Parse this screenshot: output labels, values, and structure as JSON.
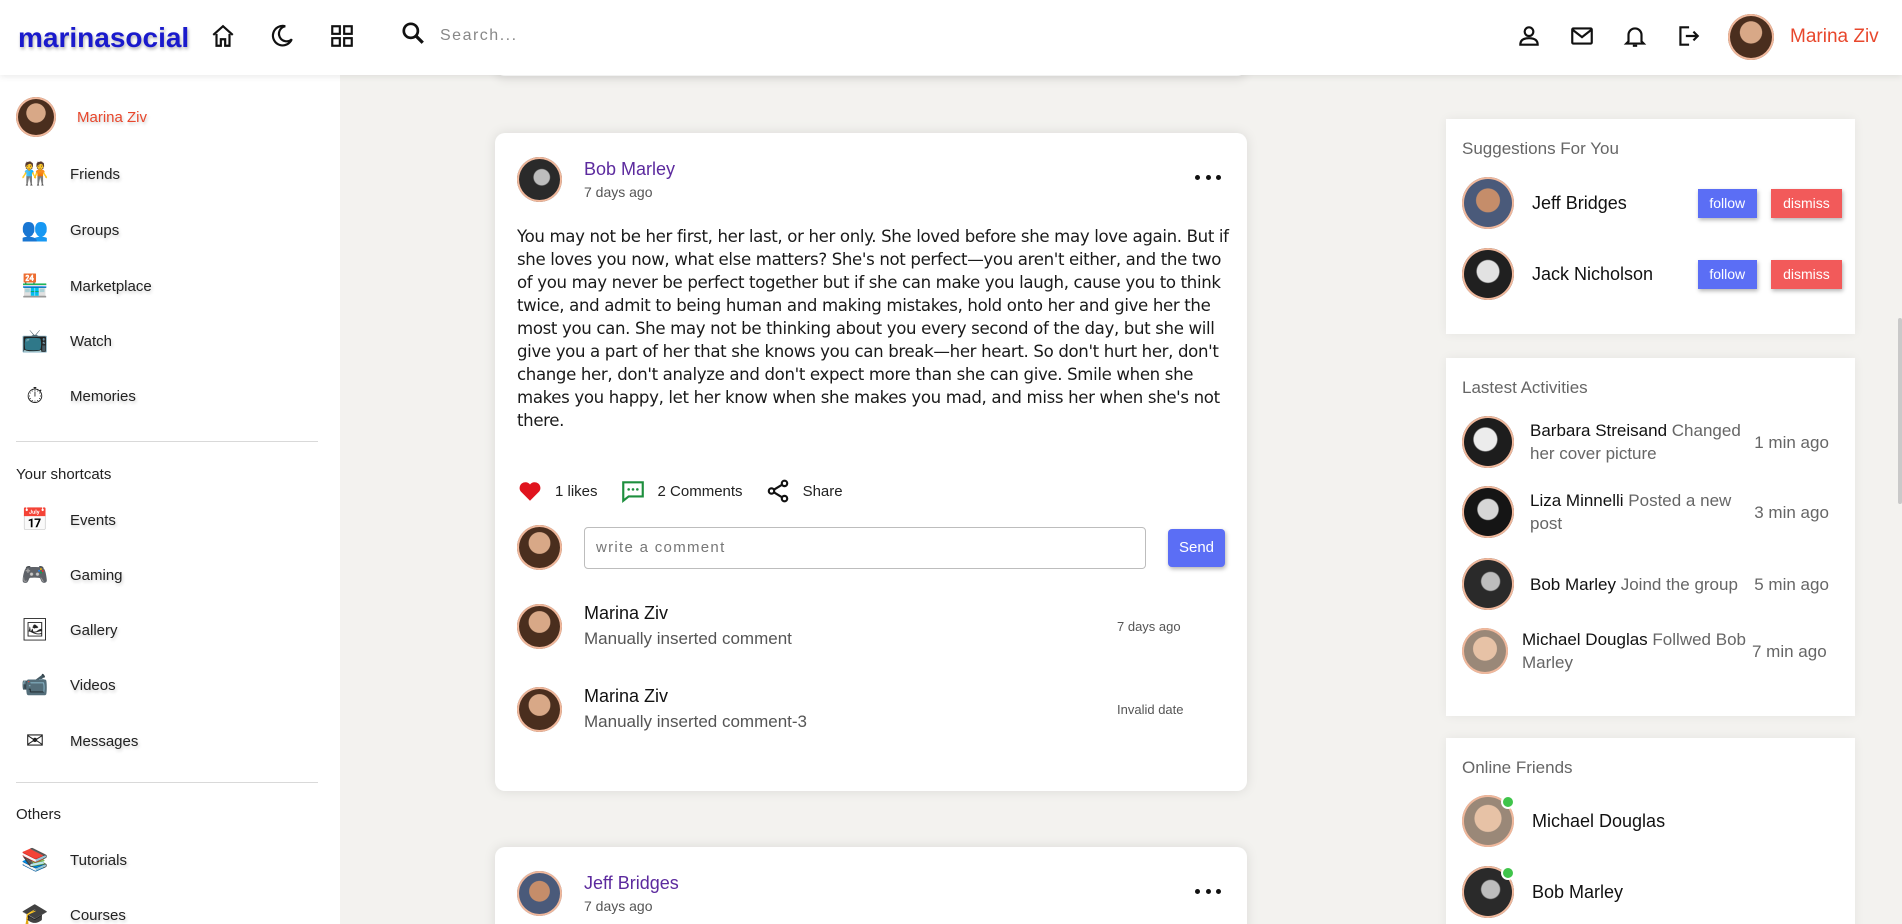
{
  "brand": {
    "logo": "marinasocial",
    "accent": "#e8472c",
    "primary": "#5b6ef5"
  },
  "search": {
    "placeholder": "Search..."
  },
  "current_user": {
    "name": "Marina Ziv"
  },
  "sidebar": {
    "items": [
      {
        "label": "Friends"
      },
      {
        "label": "Groups"
      },
      {
        "label": "Marketplace"
      },
      {
        "label": "Watch"
      },
      {
        "label": "Memories"
      }
    ],
    "shortcuts_title": "Your shortcats",
    "shortcuts": [
      {
        "label": "Events"
      },
      {
        "label": "Gaming"
      },
      {
        "label": "Gallery"
      },
      {
        "label": "Videos"
      },
      {
        "label": "Messages"
      }
    ],
    "others_title": "Others",
    "others": [
      {
        "label": "Tutorials"
      },
      {
        "label": "Courses"
      }
    ]
  },
  "posts": [
    {
      "author": "Bob Marley",
      "time": "7 days ago",
      "text": "You may not be her first, her last, or her only. She loved before she may love again. But if she loves you now, what else matters? She's not perfect—you aren't either, and the two of you may never be perfect together but if she can make you laugh, cause you to think twice, and admit to being human and making mistakes, hold onto her and give her the most you can. She may not be thinking about you every second of the day, but she will give you a part of her that she knows you can break—her heart. So don't hurt her, don't change her, don't analyze and don't expect more than she can give. Smile when she makes you happy, let her know when she makes you mad, and miss her when she's not there.",
      "likes": "1 likes",
      "comments_label": "2 Comments",
      "share_label": "Share",
      "comment_placeholder": "write a comment",
      "send_label": "Send",
      "comments": [
        {
          "name": "Marina Ziv",
          "text": "Manually inserted comment",
          "time": "7 days ago"
        },
        {
          "name": "Marina Ziv",
          "text": "Manually inserted comment-3",
          "time": "Invalid date"
        }
      ]
    },
    {
      "author": "Jeff Bridges",
      "time": "7 days ago"
    }
  ],
  "suggestions": {
    "title": "Suggestions For You",
    "follow_label": "follow",
    "dismiss_label": "dismiss",
    "people": [
      {
        "name": "Jeff Bridges"
      },
      {
        "name": "Jack Nicholson"
      }
    ]
  },
  "activities": {
    "title": "Lastest Activities",
    "items": [
      {
        "name": "Barbara Streisand",
        "action": "Changed her cover picture",
        "time": "1 min ago"
      },
      {
        "name": "Liza Minnelli",
        "action": "Posted a new post",
        "time": "3 min ago"
      },
      {
        "name": "Bob Marley",
        "action": "Joind the group",
        "time": "5 min ago"
      },
      {
        "name": "Michael Douglas",
        "action": "Follwed Bob Marley",
        "time": "7 min ago"
      }
    ]
  },
  "online_friends": {
    "title": "Online Friends",
    "people": [
      {
        "name": "Michael Douglas"
      },
      {
        "name": "Bob Marley"
      }
    ]
  }
}
